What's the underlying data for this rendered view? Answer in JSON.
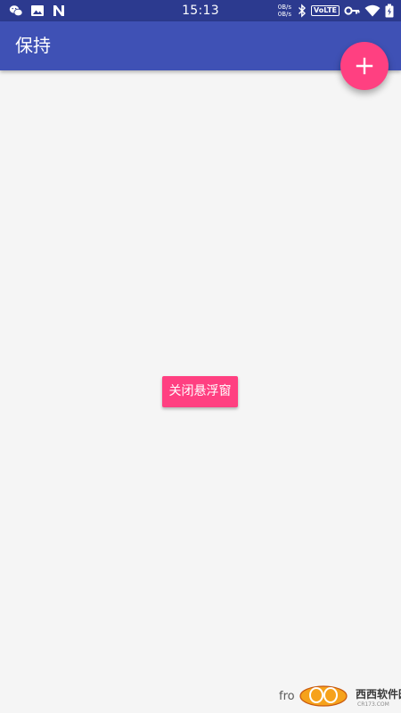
{
  "status_bar": {
    "time": "15:13",
    "net_speed_up": "0B/s",
    "net_speed_down": "0B/s",
    "volte": "VoLTE",
    "icons_left": [
      "wechat-icon",
      "image-icon",
      "n-icon"
    ],
    "icons_right": [
      "bluetooth-icon",
      "key-icon",
      "wifi-icon",
      "battery-icon"
    ]
  },
  "app_bar": {
    "title": "保持"
  },
  "fab": {
    "icon": "plus-icon"
  },
  "main": {
    "close_button_label": "关闭悬浮窗"
  },
  "watermark": {
    "prefix": "fro",
    "logo_text": "西西软件园",
    "logo_sub": "CR173.COM"
  },
  "colors": {
    "status_bar": "#2c3a8f",
    "app_bar": "#3f51b5",
    "accent": "#ff4081",
    "background": "#f5f5f5"
  }
}
